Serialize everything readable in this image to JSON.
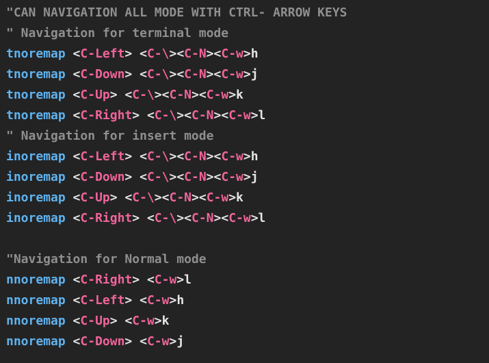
{
  "editor": {
    "lines": [
      {
        "type": "comment",
        "text": "\"CAN NAVIGATION ALL MODE WITH CTRL- ARROW KEYS"
      },
      {
        "type": "comment",
        "text": "\" Navigation for terminal mode"
      },
      {
        "type": "map",
        "cmd": "tnoremap",
        "lhs": "C-Left",
        "rhs": [
          "C-\\",
          "C-N",
          "C-w"
        ],
        "tail": "h"
      },
      {
        "type": "map",
        "cmd": "tnoremap",
        "lhs": "C-Down",
        "rhs": [
          "C-\\",
          "C-N",
          "C-w"
        ],
        "tail": "j"
      },
      {
        "type": "map",
        "cmd": "tnoremap",
        "lhs": "C-Up",
        "rhs": [
          "C-\\",
          "C-N",
          "C-w"
        ],
        "tail": "k"
      },
      {
        "type": "map",
        "cmd": "tnoremap",
        "lhs": "C-Right",
        "rhs": [
          "C-\\",
          "C-N",
          "C-w"
        ],
        "tail": "l"
      },
      {
        "type": "comment",
        "text": "\" Navigation for insert mode"
      },
      {
        "type": "map",
        "cmd": "inoremap",
        "lhs": "C-Left",
        "rhs": [
          "C-\\",
          "C-N",
          "C-w"
        ],
        "tail": "h"
      },
      {
        "type": "map",
        "cmd": "inoremap",
        "lhs": "C-Down",
        "rhs": [
          "C-\\",
          "C-N",
          "C-w"
        ],
        "tail": "j"
      },
      {
        "type": "map",
        "cmd": "inoremap",
        "lhs": "C-Up",
        "rhs": [
          "C-\\",
          "C-N",
          "C-w"
        ],
        "tail": "k"
      },
      {
        "type": "map",
        "cmd": "inoremap",
        "lhs": "C-Right",
        "rhs": [
          "C-\\",
          "C-N",
          "C-w"
        ],
        "tail": "l"
      },
      {
        "type": "blank"
      },
      {
        "type": "comment",
        "text": "\"Navigation for Normal mode"
      },
      {
        "type": "map",
        "cmd": "nnoremap",
        "lhs": "C-Right",
        "rhs": [
          "C-w"
        ],
        "tail": "l"
      },
      {
        "type": "map",
        "cmd": "nnoremap",
        "lhs": "C-Left",
        "rhs": [
          "C-w"
        ],
        "tail": "h"
      },
      {
        "type": "map",
        "cmd": "nnoremap",
        "lhs": "C-Up",
        "rhs": [
          "C-w"
        ],
        "tail": "k"
      },
      {
        "type": "map",
        "cmd": "nnoremap",
        "lhs": "C-Down",
        "rhs": [
          "C-w"
        ],
        "tail": "j"
      }
    ]
  },
  "colors": {
    "background": "#232323",
    "comment": "#8f8f8f",
    "keyword": "#5fb3f0",
    "key_name": "#f0649a",
    "text": "#e6e6e6"
  }
}
